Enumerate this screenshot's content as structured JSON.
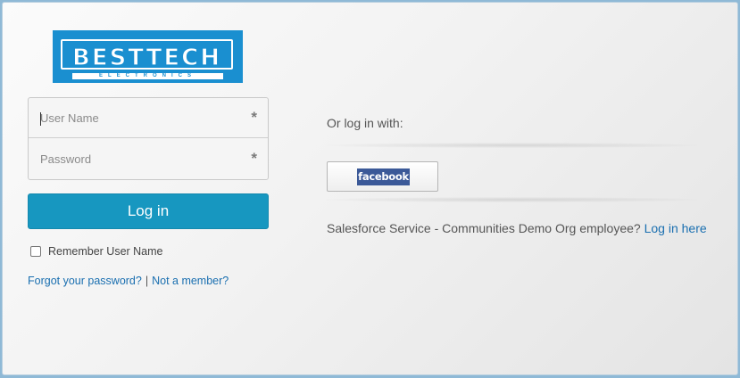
{
  "logo": {
    "brand_text": "BESTTECH",
    "sub_text": "ELECTRONICS"
  },
  "login_form": {
    "username_placeholder": "User Name",
    "password_placeholder": "Password",
    "required_mark": "*",
    "login_button_label": "Log in",
    "remember_label": "Remember User Name",
    "remember_checked": false,
    "forgot_link": "Forgot your password?",
    "separator": "|",
    "not_member_link": "Not a member?"
  },
  "social": {
    "or_label": "Or log in with:",
    "facebook_label": "facebook"
  },
  "employee": {
    "text": "Salesforce Service - Communities Demo Org employee?",
    "link": "Log in here"
  },
  "colors": {
    "accent": "#1797c0",
    "link": "#1a6fb0",
    "logo_bg": "#1a8fd0",
    "facebook": "#3b5998"
  }
}
